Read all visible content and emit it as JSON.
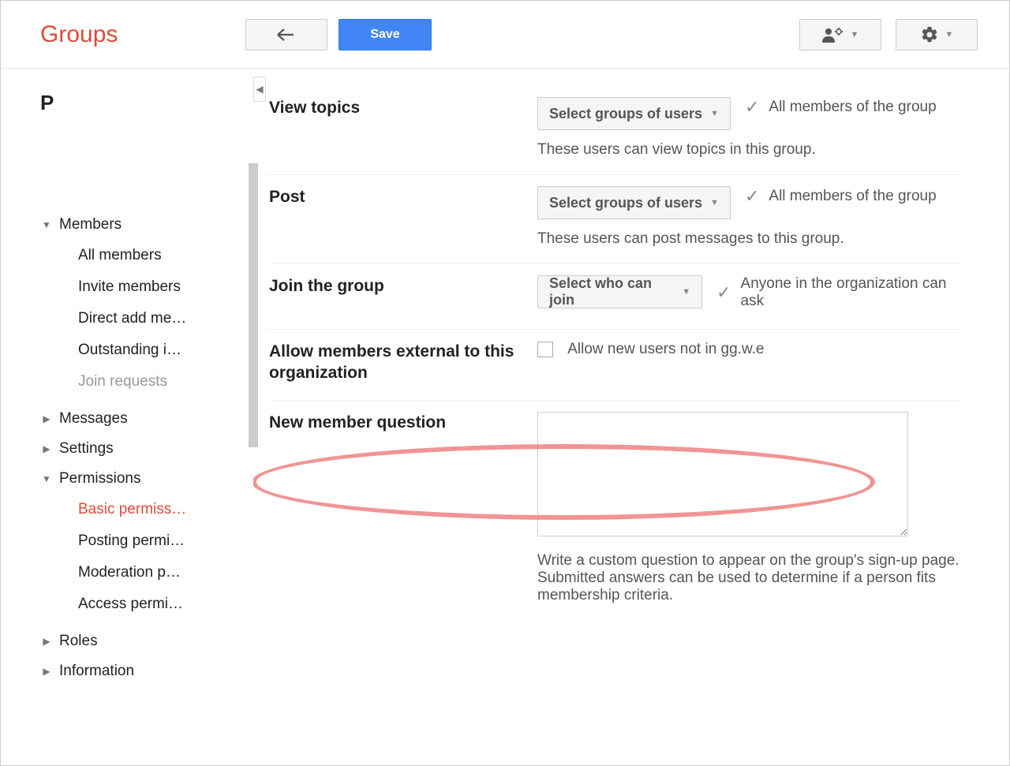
{
  "header": {
    "logo": "Groups",
    "back_label": "Back",
    "save_label": "Save"
  },
  "sidebar": {
    "letter": "P",
    "sections": {
      "members": {
        "label": "Members",
        "items": {
          "all": "All members",
          "invite": "Invite members",
          "direct": "Direct add me…",
          "outstanding": "Outstanding i…",
          "join": "Join requests"
        }
      },
      "messages": {
        "label": "Messages"
      },
      "settings": {
        "label": "Settings"
      },
      "permissions": {
        "label": "Permissions",
        "items": {
          "basic": "Basic permiss…",
          "posting": "Posting permi…",
          "moderation": "Moderation p…",
          "access": "Access permi…"
        }
      },
      "roles": {
        "label": "Roles"
      },
      "information": {
        "label": "Information"
      }
    }
  },
  "main": {
    "view_topics": {
      "label": "View topics",
      "select": "Select groups of users",
      "selected": "All members of the group",
      "desc": "These users can view topics in this group."
    },
    "post": {
      "label": "Post",
      "select": "Select groups of users",
      "selected": "All members of the group",
      "desc": "These users can post messages to this group."
    },
    "join": {
      "label": "Join the group",
      "select": "Select who can join",
      "selected": "Anyone in the organization can ask"
    },
    "external": {
      "label": "Allow members external to this organization",
      "checkbox_label": "Allow new users not in gg.w.e"
    },
    "question": {
      "label": "New member question",
      "desc": "Write a custom question to appear on the group's sign-up page. Submitted answers can be used to determine if a person fits membership criteria."
    }
  }
}
